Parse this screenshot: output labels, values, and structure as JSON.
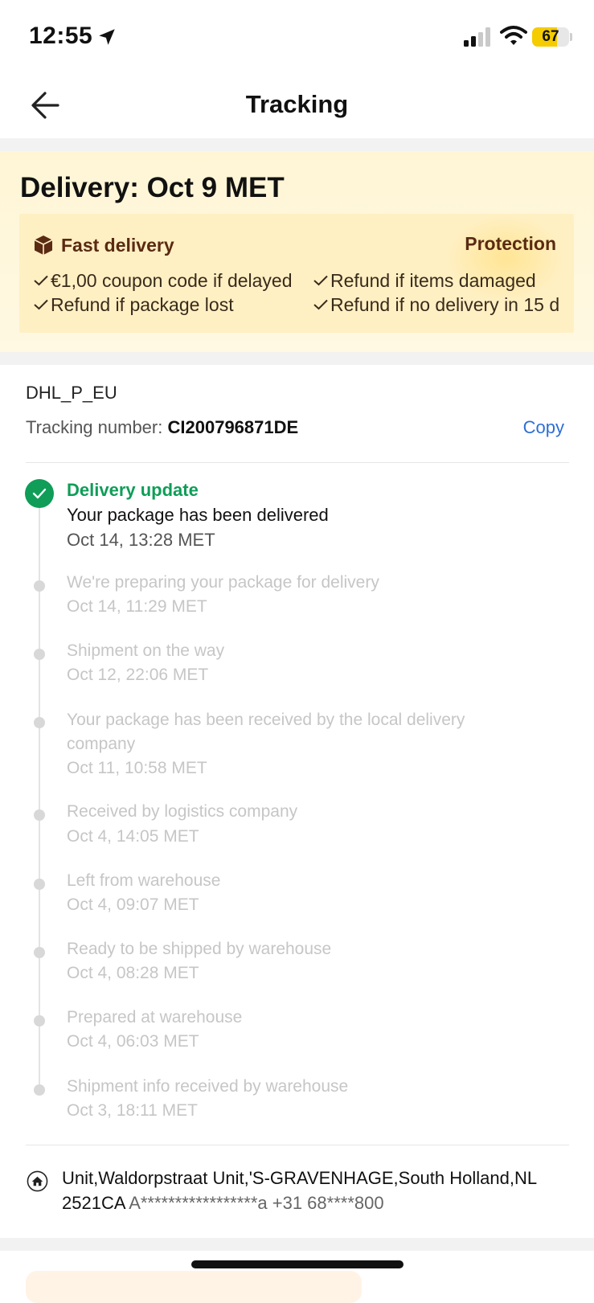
{
  "status_bar": {
    "time": "12:55",
    "battery_level": "67",
    "battery_fraction": 0.67
  },
  "header": {
    "title": "Tracking"
  },
  "banner": {
    "delivery_title": "Delivery: Oct 9 MET",
    "fast_delivery_label": "Fast delivery",
    "protection_label": "Protection",
    "benefits": [
      "€1,00 coupon code if delayed",
      "Refund if items damaged",
      "Refund if package lost",
      "Refund if no delivery in 15 d"
    ]
  },
  "tracking": {
    "carrier": "DHL_P_EU",
    "number_label": "Tracking number:",
    "number": "CI200796871DE",
    "copy_label": "Copy"
  },
  "events": [
    {
      "status": "Delivery update",
      "detail": "Your package has been delivered",
      "time": "Oct 14, 13:28 MET"
    },
    {
      "title": "We're preparing your package for delivery",
      "time": "Oct 14, 11:29 MET"
    },
    {
      "title": "Shipment on the way",
      "time": "Oct 12, 22:06 MET"
    },
    {
      "title": "Your package has been received by the local delivery company",
      "time": "Oct 11, 10:58 MET"
    },
    {
      "title": "Received by logistics company",
      "time": "Oct 4, 14:05 MET"
    },
    {
      "title": "Left from warehouse",
      "time": "Oct 4, 09:07 MET"
    },
    {
      "title": "Ready to be shipped by warehouse",
      "time": "Oct 4, 08:28 MET"
    },
    {
      "title": "Prepared at warehouse",
      "time": "Oct 4, 06:03 MET"
    },
    {
      "title": "Shipment info received by warehouse",
      "time": "Oct 3, 18:11 MET"
    }
  ],
  "address": {
    "text": "Unit,Waldorpstraat Unit,'S-GRAVENHAGE,South Holland,NL 2521CA ",
    "masked": "A*****************a +31 68****800"
  },
  "colors": {
    "accent_green": "#0f9d58",
    "link_blue": "#2e6fd6",
    "banner_bg": "#fff6d6",
    "brand_brown": "#5a2a12"
  }
}
